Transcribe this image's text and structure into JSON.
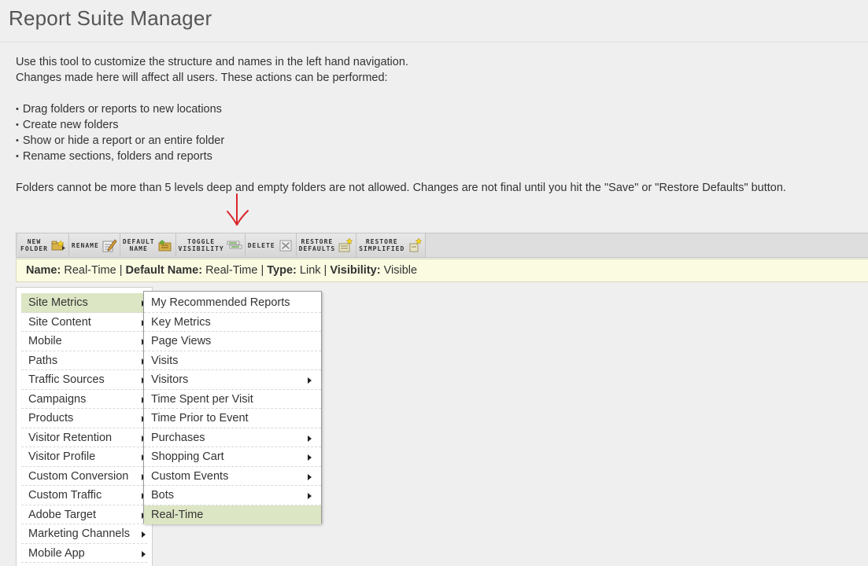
{
  "page": {
    "title": "Report Suite Manager"
  },
  "intro": {
    "line1": "Use this tool to customize the structure and names in the left hand navigation.",
    "line2": "Changes made here will affect all users. These actions can be performed:",
    "bullets": [
      "Drag folders or reports to new locations",
      "Create new folders",
      "Show or hide a report or an entire folder",
      "Rename sections, folders and reports"
    ],
    "note": "Folders cannot be more than 5 levels deep and empty folders are not allowed. Changes are not final until you hit the \"Save\" or \"Restore Defaults\" button."
  },
  "annotation": {
    "arrow_color": "#d9262b"
  },
  "toolbar": {
    "buttons": [
      {
        "label": "NEW\nFOLDER",
        "icon": "new-folder-icon"
      },
      {
        "label": "RENAME",
        "icon": "rename-icon"
      },
      {
        "label": "DEFAULT\nNAME",
        "icon": "default-name-icon"
      },
      {
        "label": "TOGGLE\nVISIBILITY",
        "icon": "toggle-visibility-icon"
      },
      {
        "label": "DELETE",
        "icon": "delete-icon"
      },
      {
        "label": "RESTORE\nDEFAULTS",
        "icon": "restore-defaults-icon"
      },
      {
        "label": "RESTORE\nSIMPLIFIED",
        "icon": "restore-simplified-icon"
      }
    ]
  },
  "info": {
    "name_label": "Name:",
    "name_value": "Real-Time",
    "default_label": "Default Name:",
    "default_value": "Real-Time",
    "type_label": "Type:",
    "type_value": "Link",
    "visibility_label": "Visibility:",
    "visibility_value": "Visible",
    "separator": "|"
  },
  "left_menu": {
    "items": [
      {
        "label": "Site Metrics",
        "active": true
      },
      {
        "label": "Site Content"
      },
      {
        "label": "Mobile"
      },
      {
        "label": "Paths"
      },
      {
        "label": "Traffic Sources"
      },
      {
        "label": "Campaigns"
      },
      {
        "label": "Products"
      },
      {
        "label": "Visitor Retention"
      },
      {
        "label": "Visitor Profile"
      },
      {
        "label": "Custom Conversion"
      },
      {
        "label": "Custom Traffic"
      },
      {
        "label": "Adobe Target"
      },
      {
        "label": "Marketing Channels"
      },
      {
        "label": "Mobile App"
      }
    ]
  },
  "submenu": {
    "items": [
      {
        "label": "My Recommended Reports",
        "has_children": false
      },
      {
        "label": "Key Metrics",
        "has_children": false
      },
      {
        "label": "Page Views",
        "has_children": false
      },
      {
        "label": "Visits",
        "has_children": false
      },
      {
        "label": "Visitors",
        "has_children": true
      },
      {
        "label": "Time Spent per Visit",
        "has_children": false
      },
      {
        "label": "Time Prior to Event",
        "has_children": false
      },
      {
        "label": "Purchases",
        "has_children": true
      },
      {
        "label": "Shopping Cart",
        "has_children": true
      },
      {
        "label": "Custom Events",
        "has_children": true
      },
      {
        "label": "Bots",
        "has_children": true
      },
      {
        "label": "Real-Time",
        "has_children": false,
        "active": true
      }
    ]
  }
}
